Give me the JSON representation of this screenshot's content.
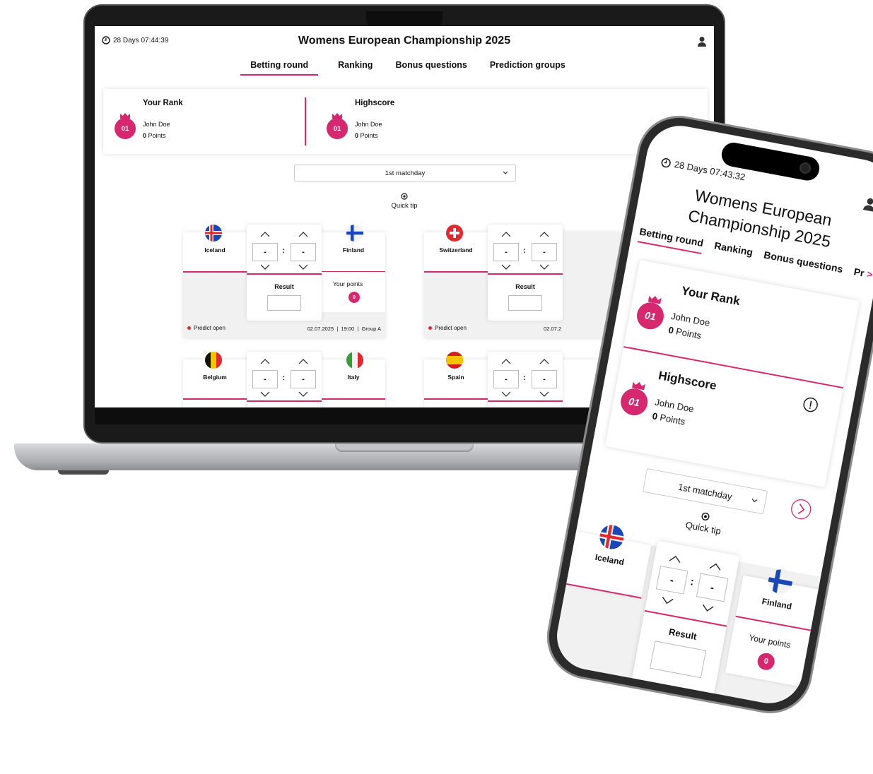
{
  "app": {
    "title": "Womens European Championship 2025",
    "tabs": [
      "Betting round",
      "Ranking",
      "Bonus questions",
      "Prediction groups"
    ],
    "accent": "#d6286f"
  },
  "desktop": {
    "timer": "28 Days 07:44:39",
    "rank": {
      "heading": "Your Rank",
      "position": "01",
      "name": "John Doe",
      "points_value": "0",
      "points_label": "Points"
    },
    "highscore": {
      "heading": "Highscore",
      "position": "01",
      "name": "John Doe",
      "points_value": "0",
      "points_label": "Points"
    },
    "matchday": "1st matchday",
    "quick_tip": "Quick tip",
    "matches": [
      {
        "home": "Iceland",
        "away": "Finland",
        "home_score": "-",
        "away_score": "-",
        "result_label": "Result",
        "your_points_label": "Your points",
        "your_points": "0",
        "status": "Predict open",
        "meta": "02.07.2025  |  19:00  |  Group A"
      },
      {
        "home": "Switzerland",
        "home_score": "-",
        "away_score": "-",
        "result_label": "Result",
        "status": "Predict open",
        "meta": "02.07.2"
      },
      {
        "home": "Belgium",
        "away": "Italy",
        "home_score": "-",
        "away_score": "-"
      },
      {
        "home": "Spain",
        "home_score": "-",
        "away_score": "-"
      }
    ]
  },
  "mobile": {
    "timer": "28 Days 07:43:32",
    "title_line1": "Womens European",
    "title_line2": "Championship 2025",
    "tabs": [
      "Betting round",
      "Ranking",
      "Bonus questions",
      "Pr"
    ],
    "rank": {
      "heading": "Your Rank",
      "position": "01",
      "name": "John Doe",
      "points_value": "0",
      "points_label": "Points"
    },
    "highscore": {
      "heading": "Highscore",
      "position": "01",
      "name": "John Doe",
      "points_value": "0",
      "points_label": "Points"
    },
    "matchday": "1st matchday",
    "quick_tip": "Quick tip",
    "match": {
      "home": "Iceland",
      "away": "Finland",
      "home_score": "-",
      "away_score": "-",
      "result_label": "Result",
      "your_points_label": "Your points",
      "your_points": "0"
    }
  }
}
